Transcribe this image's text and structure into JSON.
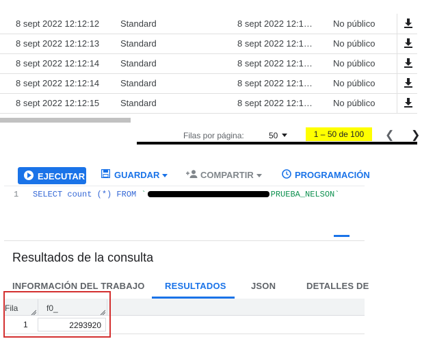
{
  "objects_table": {
    "rows": [
      {
        "created": "8 sept 2022 12:12:12",
        "storage_class": "Standard",
        "modified": "8 sept 2022 12:1…",
        "access": "No público"
      },
      {
        "created": "8 sept 2022 12:12:13",
        "storage_class": "Standard",
        "modified": "8 sept 2022 12:1…",
        "access": "No público"
      },
      {
        "created": "8 sept 2022 12:12:14",
        "storage_class": "Standard",
        "modified": "8 sept 2022 12:1…",
        "access": "No público"
      },
      {
        "created": "8 sept 2022 12:12:14",
        "storage_class": "Standard",
        "modified": "8 sept 2022 12:1…",
        "access": "No público"
      },
      {
        "created": "8 sept 2022 12:12:15",
        "storage_class": "Standard",
        "modified": "8 sept 2022 12:1…",
        "access": "No público"
      }
    ],
    "row_action_icon": "download-icon"
  },
  "pagination": {
    "rows_per_page_label": "Filas por página:",
    "rows_per_page_value": "50",
    "range": "1 – 50 de 100",
    "prev_icon": "chevron-left-icon",
    "next_icon": "chevron-right-icon"
  },
  "toolbar": {
    "run_label": "EJECUTAR",
    "save_label": "GUARDAR",
    "share_label": "COMPARTIR",
    "schedule_label": "PROGRAMACIÓN"
  },
  "editor": {
    "line_number": "1",
    "sql_prefix": "SELECT count (*) FROM ",
    "table_suffix": "PRUEBA_NELSON`",
    "table_open_quote": "`"
  },
  "results": {
    "title": "Resultados de la consulta",
    "tabs": [
      {
        "label": "INFORMACIÓN DEL TRABAJO",
        "active": false
      },
      {
        "label": "RESULTADOS",
        "active": true
      },
      {
        "label": "JSON",
        "active": false
      },
      {
        "label": "DETALLES DE",
        "active": false
      }
    ],
    "columns": [
      "Fila",
      "f0_"
    ],
    "rows": [
      {
        "row": "1",
        "f0_": "2293920"
      }
    ]
  },
  "colors": {
    "accent": "#1a73e8",
    "highlight": "#ffff00",
    "annotation_box": "#d32f2f"
  }
}
